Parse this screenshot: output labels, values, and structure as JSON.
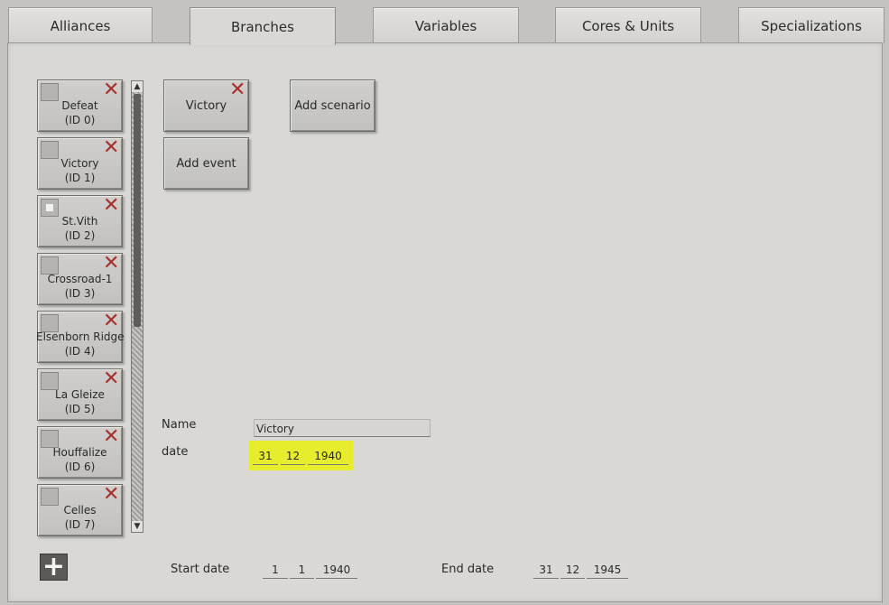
{
  "tabs": [
    {
      "label": "Alliances"
    },
    {
      "label": "Branches"
    },
    {
      "label": "Variables"
    },
    {
      "label": "Cores & Units"
    },
    {
      "label": "Specializations"
    }
  ],
  "branches": [
    {
      "name": "Defeat",
      "id": "(ID 0)"
    },
    {
      "name": "Victory",
      "id": "(ID 1)"
    },
    {
      "name": "St.Vith",
      "id": "(ID 2)"
    },
    {
      "name": "Crossroad-1",
      "id": "(ID 3)"
    },
    {
      "name": "Elsenborn Ridge",
      "id": "(ID 4)"
    },
    {
      "name": "La Gleize",
      "id": "(ID 5)"
    },
    {
      "name": "Houffalize",
      "id": "(ID 6)"
    },
    {
      "name": "Celles",
      "id": "(ID 7)"
    }
  ],
  "actions": {
    "victory": "Victory",
    "add_scenario": "Add scenario",
    "add_event": "Add event"
  },
  "details": {
    "name_label": "Name",
    "name_value": "Victory",
    "date_label": "date",
    "date": {
      "day": "31",
      "month": "12",
      "year": "1940"
    }
  },
  "campaign": {
    "start_label": "Start date",
    "start": {
      "day": "1",
      "month": "1",
      "year": "1940"
    },
    "end_label": "End date",
    "end": {
      "day": "31",
      "month": "12",
      "year": "1945"
    }
  },
  "icons": {
    "delete": "close-icon",
    "add": "plus-icon"
  },
  "colors": {
    "highlight": "#e8ee1e",
    "delete": "#a83030"
  }
}
